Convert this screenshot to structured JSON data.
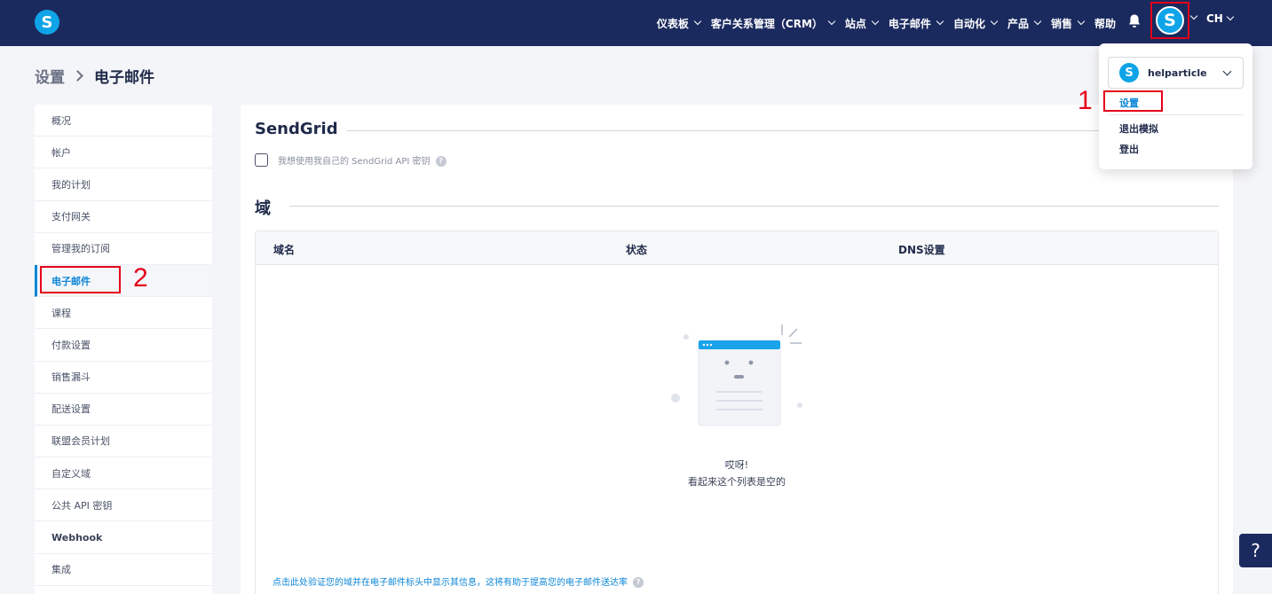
{
  "nav": {
    "items": [
      {
        "label": "仪表板"
      },
      {
        "label": "客户关系管理（CRM）"
      },
      {
        "label": "站点"
      },
      {
        "label": "电子邮件"
      },
      {
        "label": "自动化"
      },
      {
        "label": "产品"
      },
      {
        "label": "销售"
      }
    ],
    "help_label": "帮助",
    "lang_label": "CH",
    "logo_letter": "S"
  },
  "breadcrumb": {
    "parent": "设置",
    "current": "电子邮件"
  },
  "sidebar": {
    "items": [
      "概况",
      "帐户",
      "我的计划",
      "支付网关",
      "管理我的订阅",
      "电子邮件",
      "课程",
      "付款设置",
      "销售漏斗",
      "配送设置",
      "联盟会员计划",
      "自定义域",
      "公共 API 密钥",
      "Webhook",
      "集成"
    ]
  },
  "main": {
    "sendgrid_title": "SendGrid",
    "sendgrid_checkbox_label": "我想使用我自己的 SendGrid API 密钥",
    "domain_title": "域",
    "table_headers": [
      "域名",
      "状态",
      "DNS设置"
    ],
    "empty_title": "哎呀!",
    "empty_subtitle": "看起来这个列表是空的",
    "footer_link": "点击此处验证您的域并在电子邮件标头中显示其信息，这将有助于提高您的电子邮件送达率"
  },
  "dropdown": {
    "account_name": "helparticle",
    "items": [
      "设置",
      "退出模拟",
      "登出"
    ]
  },
  "annotations": {
    "num1": "1",
    "num2": "2"
  },
  "help_button": "?",
  "colors": {
    "nav_bg": "#1b2a5e",
    "brand": "#0fa4e8",
    "link": "#0c86d6",
    "highlight": "#e5001a"
  }
}
